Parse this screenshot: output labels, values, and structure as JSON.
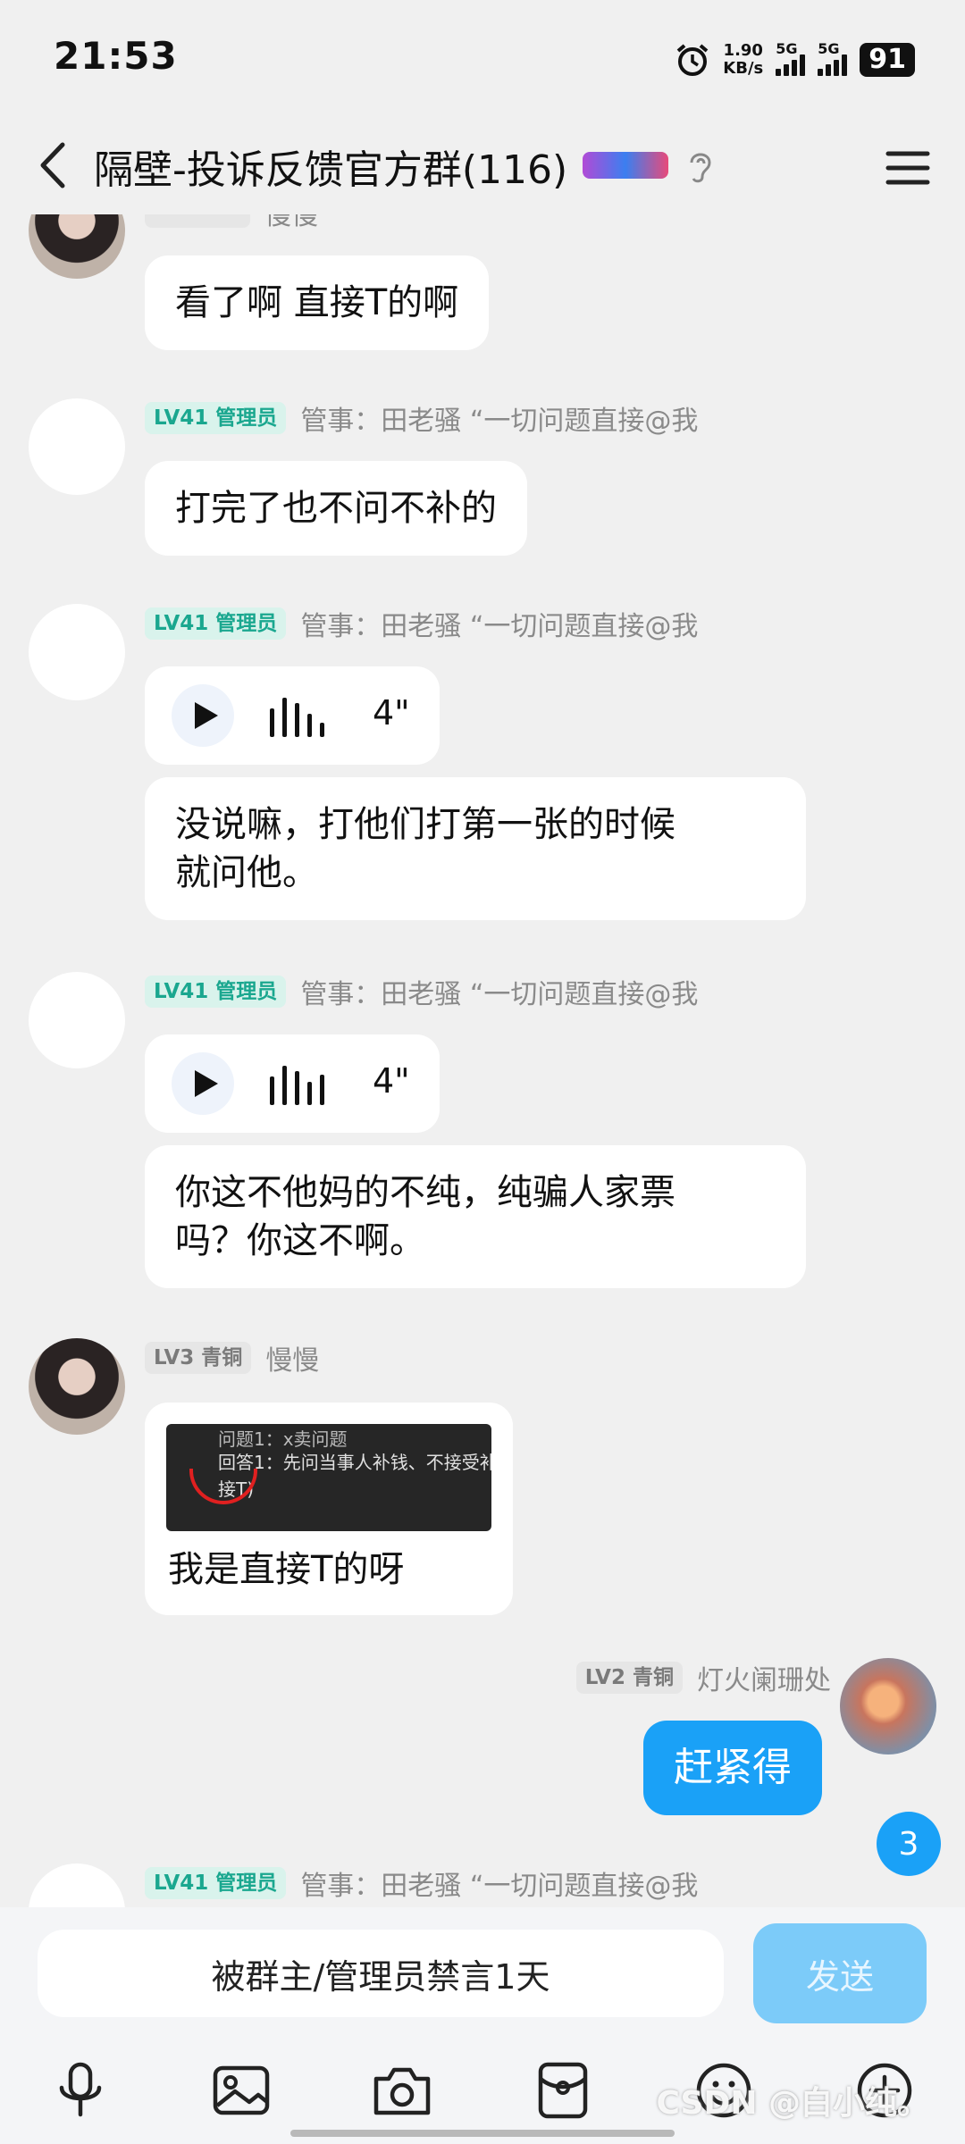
{
  "status_bar": {
    "time": "21:53",
    "net_speed": "1.90",
    "net_unit": "KB/s",
    "sim1": "5G",
    "sim2": "5G",
    "battery": "91"
  },
  "header": {
    "title": "隔壁-投诉反馈官方群(116)"
  },
  "messages": [
    {
      "text": "看了啊 直接T的啊",
      "sender_partial": "慢慢"
    },
    {
      "level": "LV41 管理员",
      "sender": "管事：田老骚 “一切问题直接@我",
      "text": "打完了也不问不补的"
    },
    {
      "level": "LV41 管理员",
      "sender": "管事：田老骚 “一切问题直接@我",
      "voice_duration": "4\"",
      "text": "没说嘛，打他们打第一张的时候\n就问他。"
    },
    {
      "level": "LV41 管理员",
      "sender": "管事：田老骚 “一切问题直接@我",
      "voice_duration": "4\"",
      "text": "你这不他妈的不纯，纯骗人家票\n吗？你这不啊。"
    },
    {
      "level": "LV3 青铜",
      "sender": "慢慢",
      "image_lines": [
        "问题1：x卖问题",
        "回答1：先问当事人补钱、不接受补",
        "接T)"
      ],
      "text": "我是直接T的呀"
    },
    {
      "level": "LV2 青铜",
      "sender": "灯火阑珊处",
      "text": "赶紧得"
    },
    {
      "level": "LV41 管理员",
      "sender": "管事：田老骚 “一切问题直接@我"
    }
  ],
  "unread_count": "3",
  "input": {
    "muted_text": "被群主/管理员禁言1天",
    "send_label": "发送"
  },
  "toolbar_icons": [
    "microphone-icon",
    "image-icon",
    "camera-icon",
    "red-packet-icon",
    "emoji-icon",
    "plus-icon"
  ],
  "watermark": "CSDN @白小纯。",
  "colors": {
    "accent": "#1aa1f7",
    "admin_tag": "#1aa78f",
    "background": "#f0f0f0"
  }
}
